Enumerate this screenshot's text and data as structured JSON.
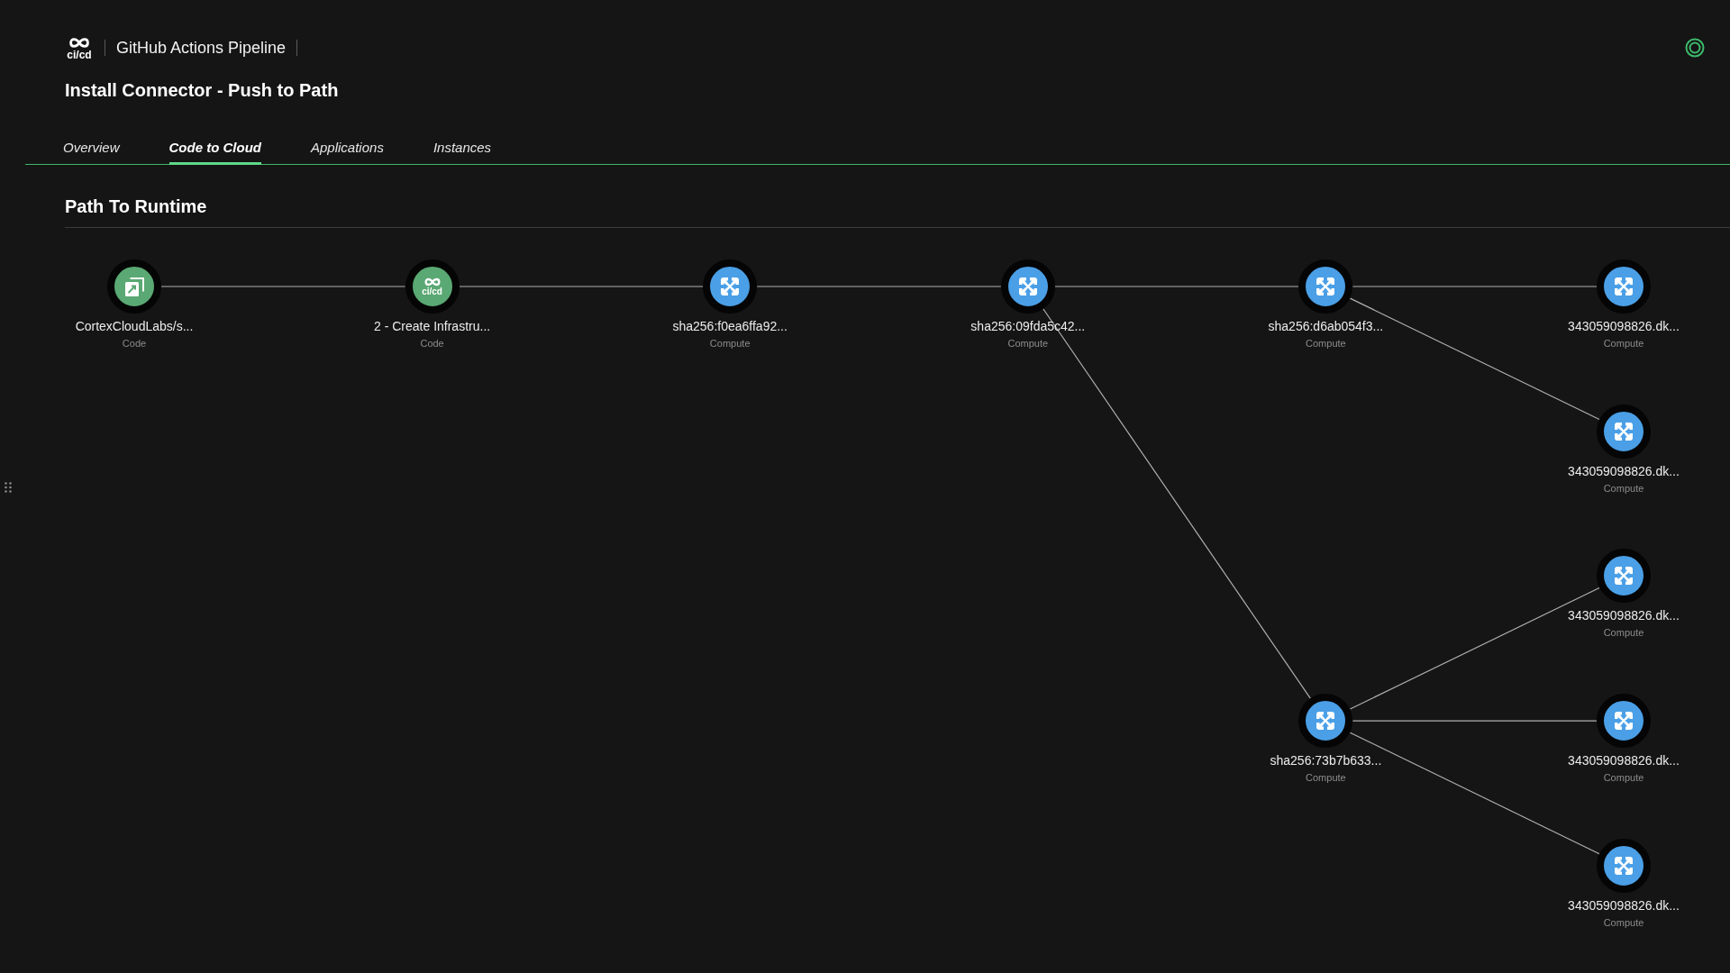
{
  "header": {
    "logo_text": "ci/cd",
    "pipeline_name": "GitHub Actions Pipeline",
    "title": "Install Connector - Push to Path"
  },
  "tabs": [
    {
      "label": "Overview",
      "selected": false
    },
    {
      "label": "Code to Cloud",
      "selected": true
    },
    {
      "label": "Applications",
      "selected": false
    },
    {
      "label": "Instances",
      "selected": false
    }
  ],
  "section": {
    "title": "Path To Runtime"
  },
  "graph": {
    "root": {
      "label": "CortexCloudLabs/s...",
      "category": "Code",
      "kind": "repo",
      "children": [
        {
          "label": "2 - Create Infrastru...",
          "category": "Code",
          "kind": "cicd",
          "icon_text": "ci/cd",
          "children": [
            {
              "label": "sha256:f0ea6ffa92...",
              "category": "Compute",
              "kind": "compute",
              "children": [
                {
                  "label": "sha256:09fda5c42...",
                  "category": "Compute",
                  "kind": "compute",
                  "children": [
                    {
                      "label": "sha256:d6ab054f3...",
                      "category": "Compute",
                      "kind": "compute",
                      "children": [
                        {
                          "label": "343059098826.dk...",
                          "category": "Compute",
                          "kind": "compute"
                        },
                        {
                          "label": "343059098826.dk...",
                          "category": "Compute",
                          "kind": "compute"
                        }
                      ]
                    },
                    {
                      "label": "sha256:73b7b633...",
                      "category": "Compute",
                      "kind": "compute",
                      "children": [
                        {
                          "label": "343059098826.dk...",
                          "category": "Compute",
                          "kind": "compute"
                        },
                        {
                          "label": "343059098826.dk...",
                          "category": "Compute",
                          "kind": "compute"
                        },
                        {
                          "label": "343059098826.dk...",
                          "category": "Compute",
                          "kind": "compute"
                        }
                      ]
                    }
                  ]
                }
              ]
            }
          ]
        }
      ]
    }
  }
}
